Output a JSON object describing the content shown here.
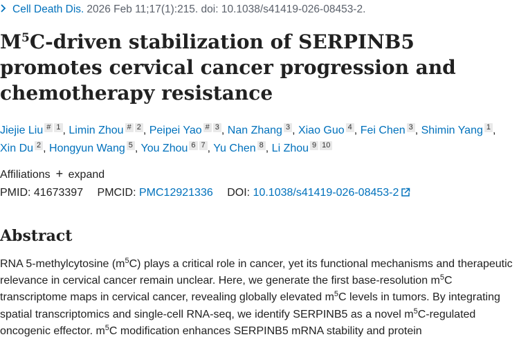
{
  "citation": {
    "journal": "Cell Death Dis.",
    "details": "2026 Feb 11;17(1):215. doi: 10.1038/s41419-026-08453-2."
  },
  "title": {
    "part1": "M",
    "sup": "5",
    "part2": "C-driven stabilization of SERPINB5 promotes cervical cancer progression and chemotherapy resistance"
  },
  "authors": [
    {
      "name": "Jiejie Liu",
      "sups": [
        "#",
        "1"
      ]
    },
    {
      "name": "Limin Zhou",
      "sups": [
        "#",
        "2"
      ]
    },
    {
      "name": "Peipei Yao",
      "sups": [
        "#",
        "3"
      ]
    },
    {
      "name": "Nan Zhang",
      "sups": [
        "3"
      ]
    },
    {
      "name": "Xiao Guo",
      "sups": [
        "4"
      ]
    },
    {
      "name": "Fei Chen",
      "sups": [
        "3"
      ]
    },
    {
      "name": "Shimin Yang",
      "sups": [
        "1"
      ]
    },
    {
      "name": "Xin Du",
      "sups": [
        "2"
      ]
    },
    {
      "name": "Hongyun Wang",
      "sups": [
        "5"
      ]
    },
    {
      "name": "You Zhou",
      "sups": [
        "6",
        "7"
      ]
    },
    {
      "name": "Yu Chen",
      "sups": [
        "8"
      ]
    },
    {
      "name": "Li Zhou",
      "sups": [
        "9",
        "10"
      ]
    }
  ],
  "affiliations": {
    "label": "Affiliations",
    "expand": "expand"
  },
  "ids": {
    "pmid_label": "PMID:",
    "pmid": "41673397",
    "pmcid_label": "PMCID:",
    "pmcid": "PMC12921336",
    "doi_label": "DOI:",
    "doi": "10.1038/s41419-026-08453-2"
  },
  "abstract": {
    "heading": "Abstract",
    "s1": "RNA 5-methylcytosine (m",
    "s2": "C) plays a critical role in cancer, yet its functional mechanisms and therapeutic relevance in cervical cancer remain unclear. Here, we generate the first base-resolution m",
    "s3": "C transcriptome maps in cervical cancer, revealing globally elevated m",
    "s4": "C levels in tumors. By integrating spatial transcriptomics and single-cell RNA-seq, we identify SERPINB5 as a novel m",
    "s5": "C-regulated oncogenic effector. m",
    "s6": "C modification enhances SERPINB5 mRNA stability and protein",
    "sup": "5"
  }
}
